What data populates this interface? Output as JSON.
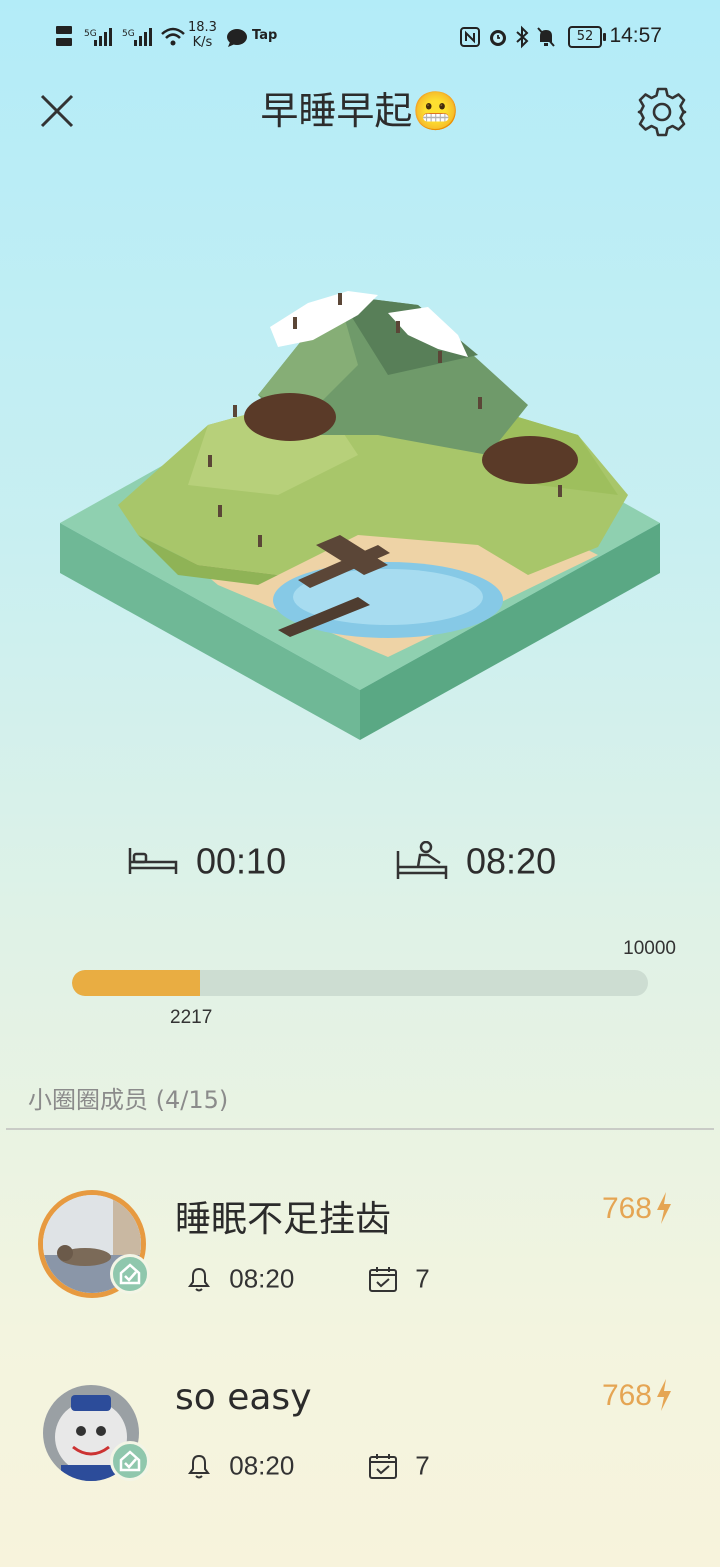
{
  "status_bar": {
    "speed_value": "18.3",
    "speed_unit": "K/s",
    "app_label": "Tap",
    "battery": "52",
    "time": "14:57"
  },
  "header": {
    "title": "早睡早起😬"
  },
  "schedule": {
    "bedtime": "00:10",
    "wake_time": "08:20"
  },
  "progress": {
    "goal": "10000",
    "current": "2217",
    "fraction": 0.2217
  },
  "members": {
    "title": "小圈圈成员 (4/15)",
    "items": [
      {
        "name": "睡眠不足挂齿",
        "score": "768",
        "alarm": "08:20",
        "days": "7"
      },
      {
        "name": "so easy",
        "score": "768",
        "alarm": "08:20",
        "days": "7"
      }
    ]
  },
  "colors": {
    "accent": "#e9ad42",
    "score": "#e5a553",
    "badge": "#8fc7ad"
  }
}
